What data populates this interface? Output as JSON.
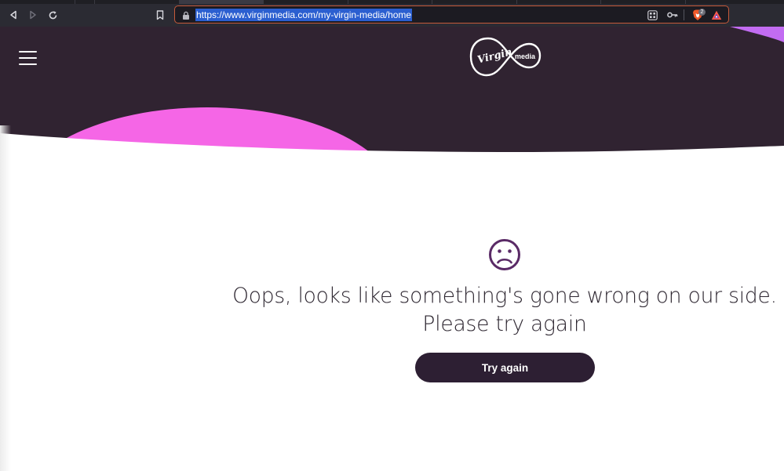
{
  "browser": {
    "url": "https://www.virginmedia.com/my-virgin-media/home",
    "icons": {
      "back": "back-arrow-icon",
      "forward": "forward-arrow-icon",
      "reload": "reload-icon",
      "bookmark": "bookmark-icon",
      "lock": "lock-icon",
      "qr": "qr-code-icon",
      "key": "key-icon",
      "shields": "brave-shields-icon",
      "rewards": "brave-rewards-icon"
    },
    "shields_badge": "2"
  },
  "header": {
    "menu_icon": "hamburger-menu-icon",
    "logo_text_script": "Virgin",
    "logo_text_media": "media"
  },
  "error": {
    "icon": "sad-face-icon",
    "line1": "Oops, looks like something's gone wrong on our side.",
    "line2": "Please try again",
    "button_label": "Try again"
  },
  "colors": {
    "header_bg": "#302331",
    "accent_pink": "#f566e6",
    "accent_purple": "#c26cf2",
    "button_bg": "#2d1f33",
    "icon_purple": "#5a2a66",
    "text": "#2d2630"
  }
}
